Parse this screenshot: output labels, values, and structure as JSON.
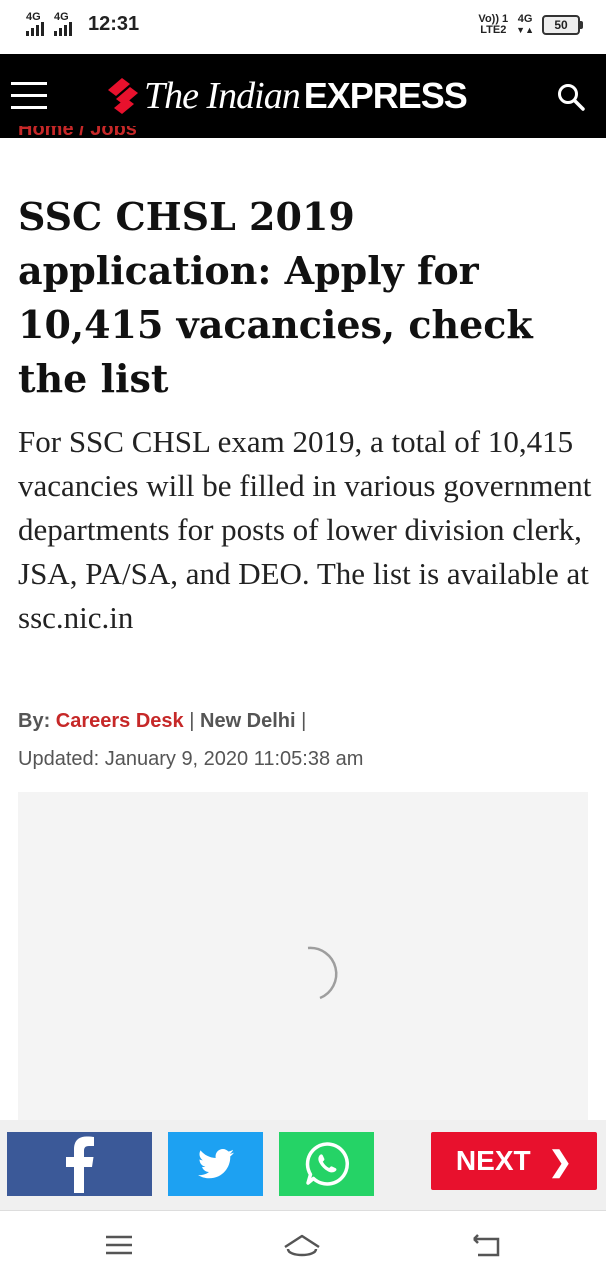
{
  "status": {
    "net1": "4G",
    "net2": "4G",
    "time": "12:31",
    "volte": "Vo)) 1",
    "lte": "LTE2",
    "net3": "4G",
    "battery": "50"
  },
  "header": {
    "logo_serif": "The Indian",
    "logo_bold": "EXPRESS"
  },
  "breadcrumb": "Home  /  Jobs",
  "article": {
    "title": "SSC CHSL 2019 application: Apply for 10,415 vacancies, check the list",
    "summary": "For SSC CHSL exam 2019, a total of 10,415 vacancies will be filled in various government departments for posts of lower division clerk, JSA, PA/SA, and DEO. The list is available at ssc.nic.in",
    "by_label": "By:",
    "author": "Careers Desk",
    "location": "New Delhi",
    "sep": "|",
    "updated": "Updated: January 9, 2020 11:05:38 am"
  },
  "share": {
    "next_label": "NEXT"
  },
  "colors": {
    "accent": "#e8112d",
    "facebook": "#3b5998",
    "twitter": "#1da1f2",
    "whatsapp": "#25d366"
  }
}
